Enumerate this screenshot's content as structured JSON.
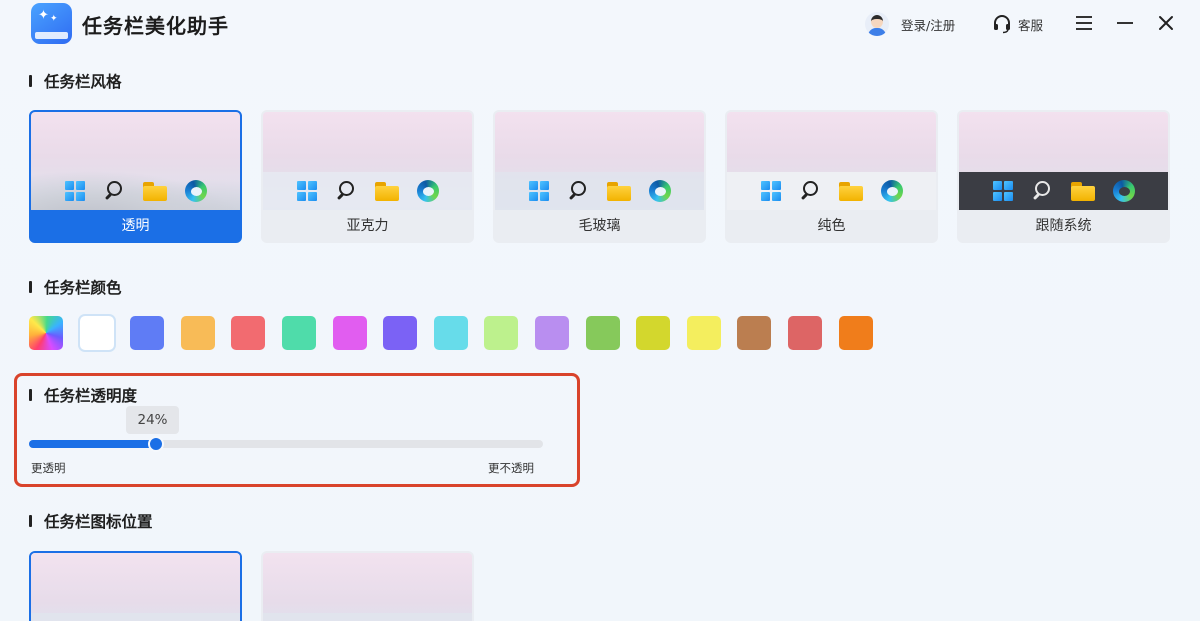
{
  "app": {
    "title": "任务栏美化助手",
    "login_label": "登录/注册",
    "service_label": "客服",
    "icons": [
      "app-logo-icon",
      "avatar-icon",
      "headset-icon",
      "menu-icon",
      "minimize-icon",
      "close-icon"
    ]
  },
  "sections": {
    "style": "任务栏风格",
    "color": "任务栏颜色",
    "opacity": "任务栏透明度",
    "icon_position": "任务栏图标位置"
  },
  "styles": [
    {
      "label": "透明",
      "selected": true
    },
    {
      "label": "亚克力",
      "selected": false
    },
    {
      "label": "毛玻璃",
      "selected": false
    },
    {
      "label": "纯色",
      "selected": false
    },
    {
      "label": "跟随系统",
      "selected": false
    }
  ],
  "colors": {
    "swatches": [
      "gradient",
      "#ffffff",
      "#5f7cf5",
      "#f8bb57",
      "#f26b70",
      "#4fdcaa",
      "#e15df0",
      "#7b62f5",
      "#67dcea",
      "#bdf18d",
      "#b98ef0",
      "#86c95b",
      "#d3d72d",
      "#f4ee5e",
      "#bb7e50",
      "#dd6565",
      "#f07d1b"
    ],
    "selected_index": 1
  },
  "opacity": {
    "value_label": "24%",
    "value": 24,
    "min_label": "更透明",
    "max_label": "更不透明",
    "accent": "#1b6fe6"
  },
  "icon_positions": {
    "selected_index": 0
  }
}
